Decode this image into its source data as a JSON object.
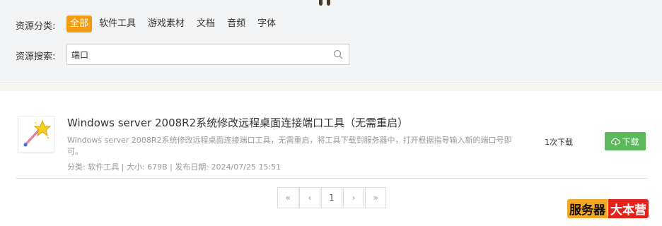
{
  "filter": {
    "category_label": "资源分类:",
    "categories": [
      "全部",
      "软件工具",
      "游戏素材",
      "文档",
      "音频",
      "字体"
    ],
    "active_index": 0,
    "search_label": "资源搜索:",
    "search_value": "端口"
  },
  "results": [
    {
      "title": "Windows server 2008R2系统修改远程桌面连接端口工具（无需重启）",
      "description": "Windows server 2008R2系统修改远程桌面连接端口工具，无需重启，将工具下载到服务器中，打开根据指导输入新的端口号即可。",
      "meta": "分类: 软件工具 | 大小: 679B | 发布日期: 2024/07/25 15:51",
      "download_count": "1次下载",
      "download_label": "下载",
      "thumbnail_icon": "magic-wand-star-icon"
    }
  ],
  "pagination": {
    "first": "«",
    "prev": "‹",
    "current": "1",
    "next": "›",
    "last": "»"
  },
  "watermark": {
    "part1": "服务器",
    "part2": "大本营"
  },
  "colors": {
    "accent": "#f39c12",
    "download": "#5cb85c",
    "watermark_orange": "#f5a623",
    "watermark_red": "#e3221c"
  }
}
